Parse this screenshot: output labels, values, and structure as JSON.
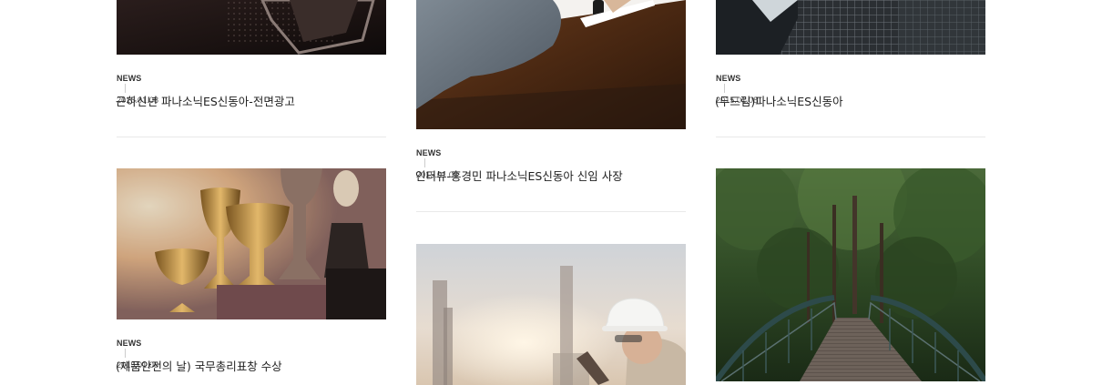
{
  "posts": [
    {
      "category": "NEWS",
      "date": "2015.01.08",
      "title": "근하신년 파나소닉ES신동아-전면광고",
      "image": "dark-frame-dots-photo"
    },
    {
      "category": "NEWS",
      "date": "2015.01.08",
      "title": "인터뷰-홍경민 파나소닉ES신동아 신임 사장",
      "image": "man-writing-at-desk-photo"
    },
    {
      "category": "NEWS",
      "date": "2015.01.08",
      "title": "(두드림)파나소닉ES신동아",
      "image": "glass-skyscraper-photo"
    },
    {
      "category": "NEWS",
      "date": "2015.01.08",
      "title": "(제품안전의 날) 국무총리표창 수상",
      "image": "trophies-photo"
    },
    {
      "category": "NEWS",
      "date": "",
      "title": "",
      "image": "engineer-hardhat-tablet-photo"
    },
    {
      "category": "NEWS",
      "date": "",
      "title": "",
      "image": "forest-bridge-photo"
    }
  ],
  "colors": {
    "text": "#222222",
    "meta": "#555555",
    "divider": "#e9e9e9"
  }
}
